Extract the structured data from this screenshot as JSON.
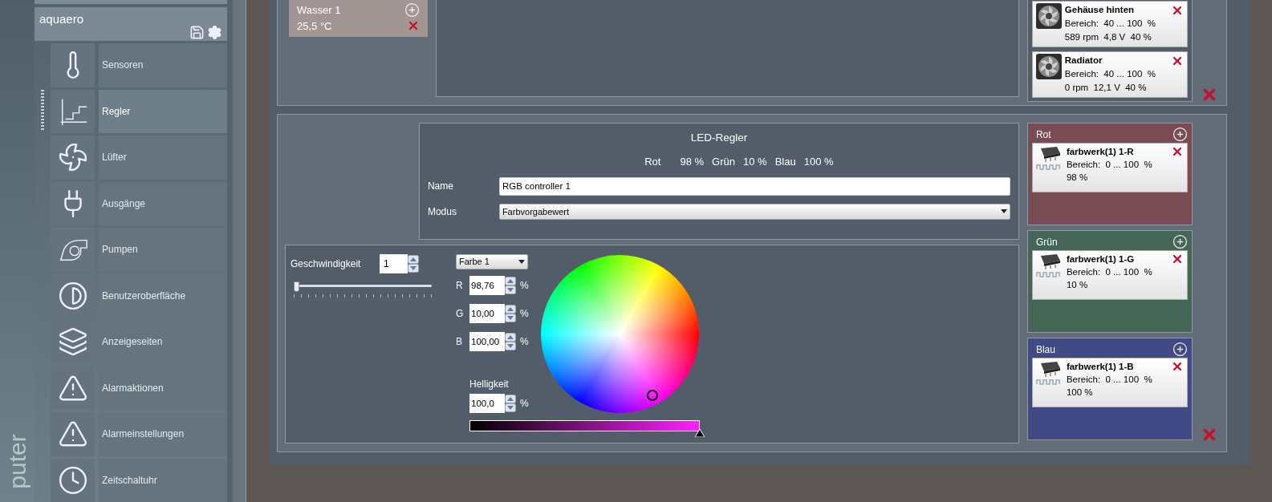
{
  "side_label": "puter",
  "device": {
    "name": "aquaero"
  },
  "menu": [
    {
      "label": "Sensoren",
      "selected": false
    },
    {
      "label": "Regler",
      "selected": true
    },
    {
      "label": "Lüfter",
      "selected": false
    },
    {
      "label": "Ausgänge",
      "selected": false
    },
    {
      "label": "Pumpen",
      "selected": false
    },
    {
      "label": "Benutzeroberfläche",
      "selected": false
    },
    {
      "label": "Anzeigeseiten",
      "selected": false
    },
    {
      "label": "Alarmaktionen",
      "selected": false
    },
    {
      "label": "Alarmeinstellungen",
      "selected": false
    },
    {
      "label": "Zeitschaltuhr",
      "selected": false
    }
  ],
  "sensor": {
    "name": "Wasser 1",
    "value": "25,5 °C"
  },
  "fans": [
    {
      "name": "Gehäuse hinten",
      "range": "Bereich:  40 ... 100  %",
      "status": "589 rpm  4,8 V  40 %"
    },
    {
      "name": "Radiator",
      "range": "Bereich:  40 ... 100  %",
      "status": "0 rpm  12,1 V  40 %"
    }
  ],
  "led": {
    "title": "LED-Regler",
    "summary": [
      {
        "label": "Rot",
        "value": "98 %"
      },
      {
        "label": "Grün",
        "value": "10 %"
      },
      {
        "label": "Blau",
        "value": "100 %"
      }
    ],
    "name_label": "Name",
    "name_value": "RGB controller 1",
    "mode_label": "Modus",
    "mode_value": "Farbvorgabewert",
    "speed_label": "Geschwindigkeit",
    "speed_value": "1",
    "speed_slider": {
      "level": 0
    },
    "color_select": "Farbe 1",
    "channels": [
      {
        "label": "R",
        "value": "98,76",
        "unit": "%"
      },
      {
        "label": "G",
        "value": "10,00",
        "unit": "%"
      },
      {
        "label": "B",
        "value": "100,00",
        "unit": "%"
      }
    ],
    "brightness_label": "Helligkeit",
    "brightness_value": "100,0",
    "brightness_unit": "%",
    "brightness_bar": {
      "level": 1
    }
  },
  "outputs": [
    {
      "name": "Rot",
      "color": "#784b55",
      "device": {
        "name": "farbwerk(1) 1-R",
        "range": "Bereich:  0 ... 100  %",
        "value": "98 %"
      }
    },
    {
      "name": "Grün",
      "color": "#456656",
      "device": {
        "name": "farbwerk(1) 1-G",
        "range": "Bereich:  0 ... 100  %",
        "value": "10 %"
      }
    },
    {
      "name": "Blau",
      "color": "#424a85",
      "device": {
        "name": "farbwerk(1) 1-B",
        "range": "Bereich:  0 ... 100  %",
        "value": "100 %"
      }
    }
  ]
}
